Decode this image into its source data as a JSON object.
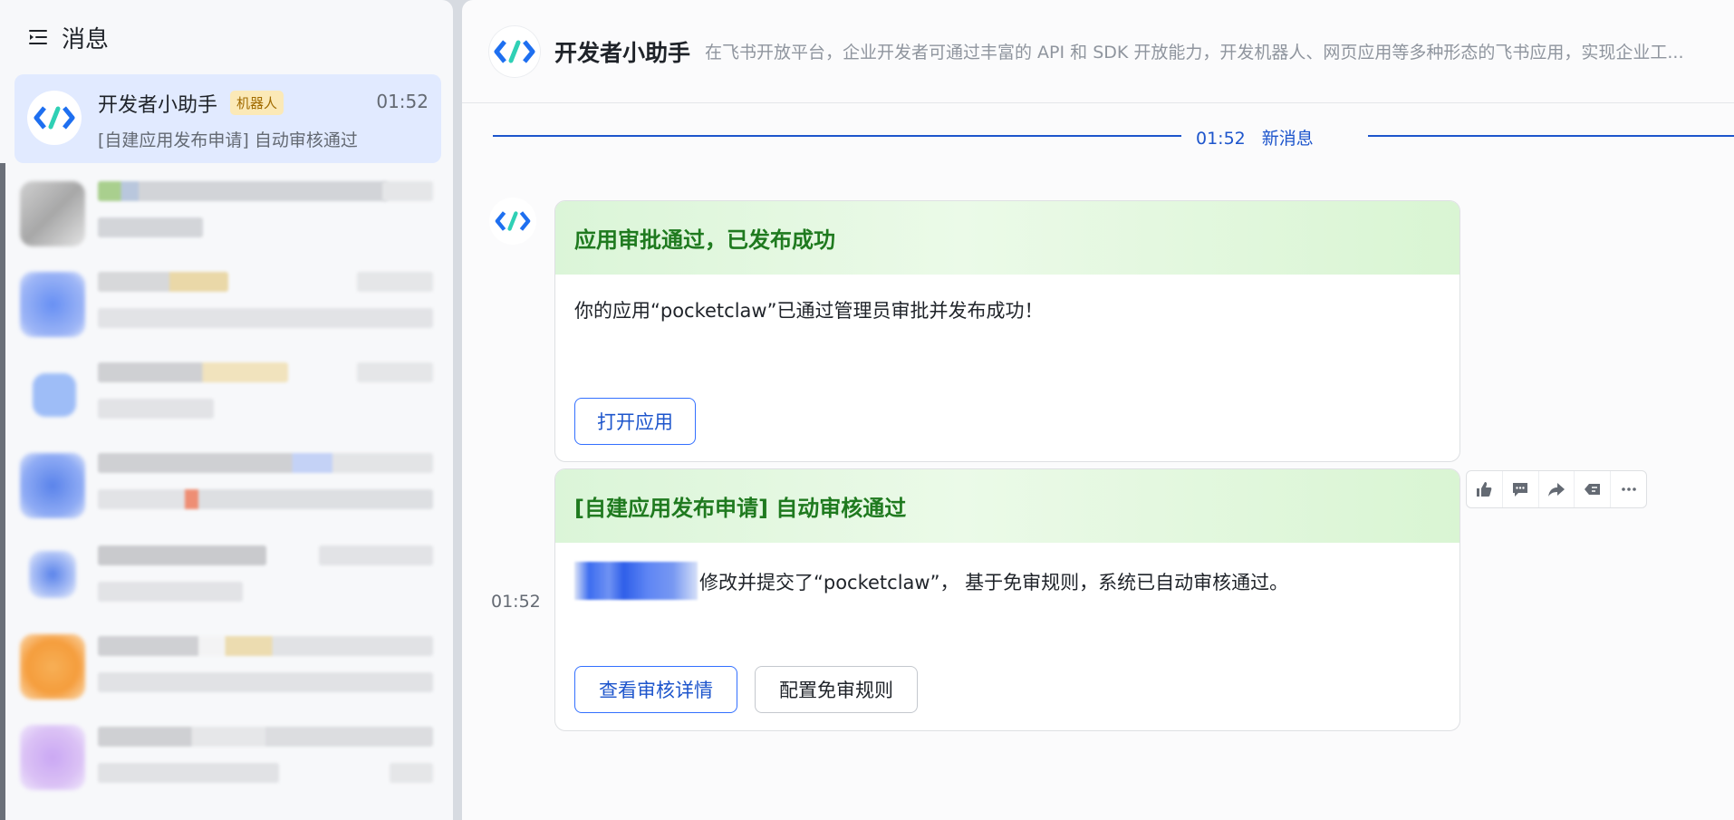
{
  "sidebar": {
    "title": "消息",
    "active_chat": {
      "name": "开发者小助手",
      "tag": "机器人",
      "time": "01:52",
      "preview": "[自建应用发布申请] 自动审核通过"
    }
  },
  "header": {
    "title": "开发者小助手",
    "description": "在飞书开放平台，企业开发者可通过丰富的 API 和 SDK 开放能力，开发机器人、网页应用等多种形态的飞书应用，实现企业工..."
  },
  "divider": {
    "time": "01:52",
    "label": "新消息"
  },
  "messages": {
    "card1": {
      "title": "应用审批通过，已发布成功",
      "body": "你的应用“pocketclaw”已通过管理员审批并发布成功！",
      "button": "打开应用"
    },
    "card2": {
      "title": "[自建应用发布申请] 自动审核通过",
      "body": "修改并提交了“pocketclaw”， 基于免审规则，系统已自动审核通过。",
      "button_primary": "查看审核详情",
      "button_secondary": "配置免审规则",
      "time": "01:52"
    }
  },
  "toolbar_icons": [
    "thumbs-up-icon",
    "comment-icon",
    "forward-icon",
    "reply-icon",
    "more-icon"
  ],
  "colors": {
    "accent": "#1d55cc",
    "active_chat_bg": "#e1eaff",
    "card_title": "#1f7a1f",
    "tag_bg": "#fbe9b7"
  }
}
